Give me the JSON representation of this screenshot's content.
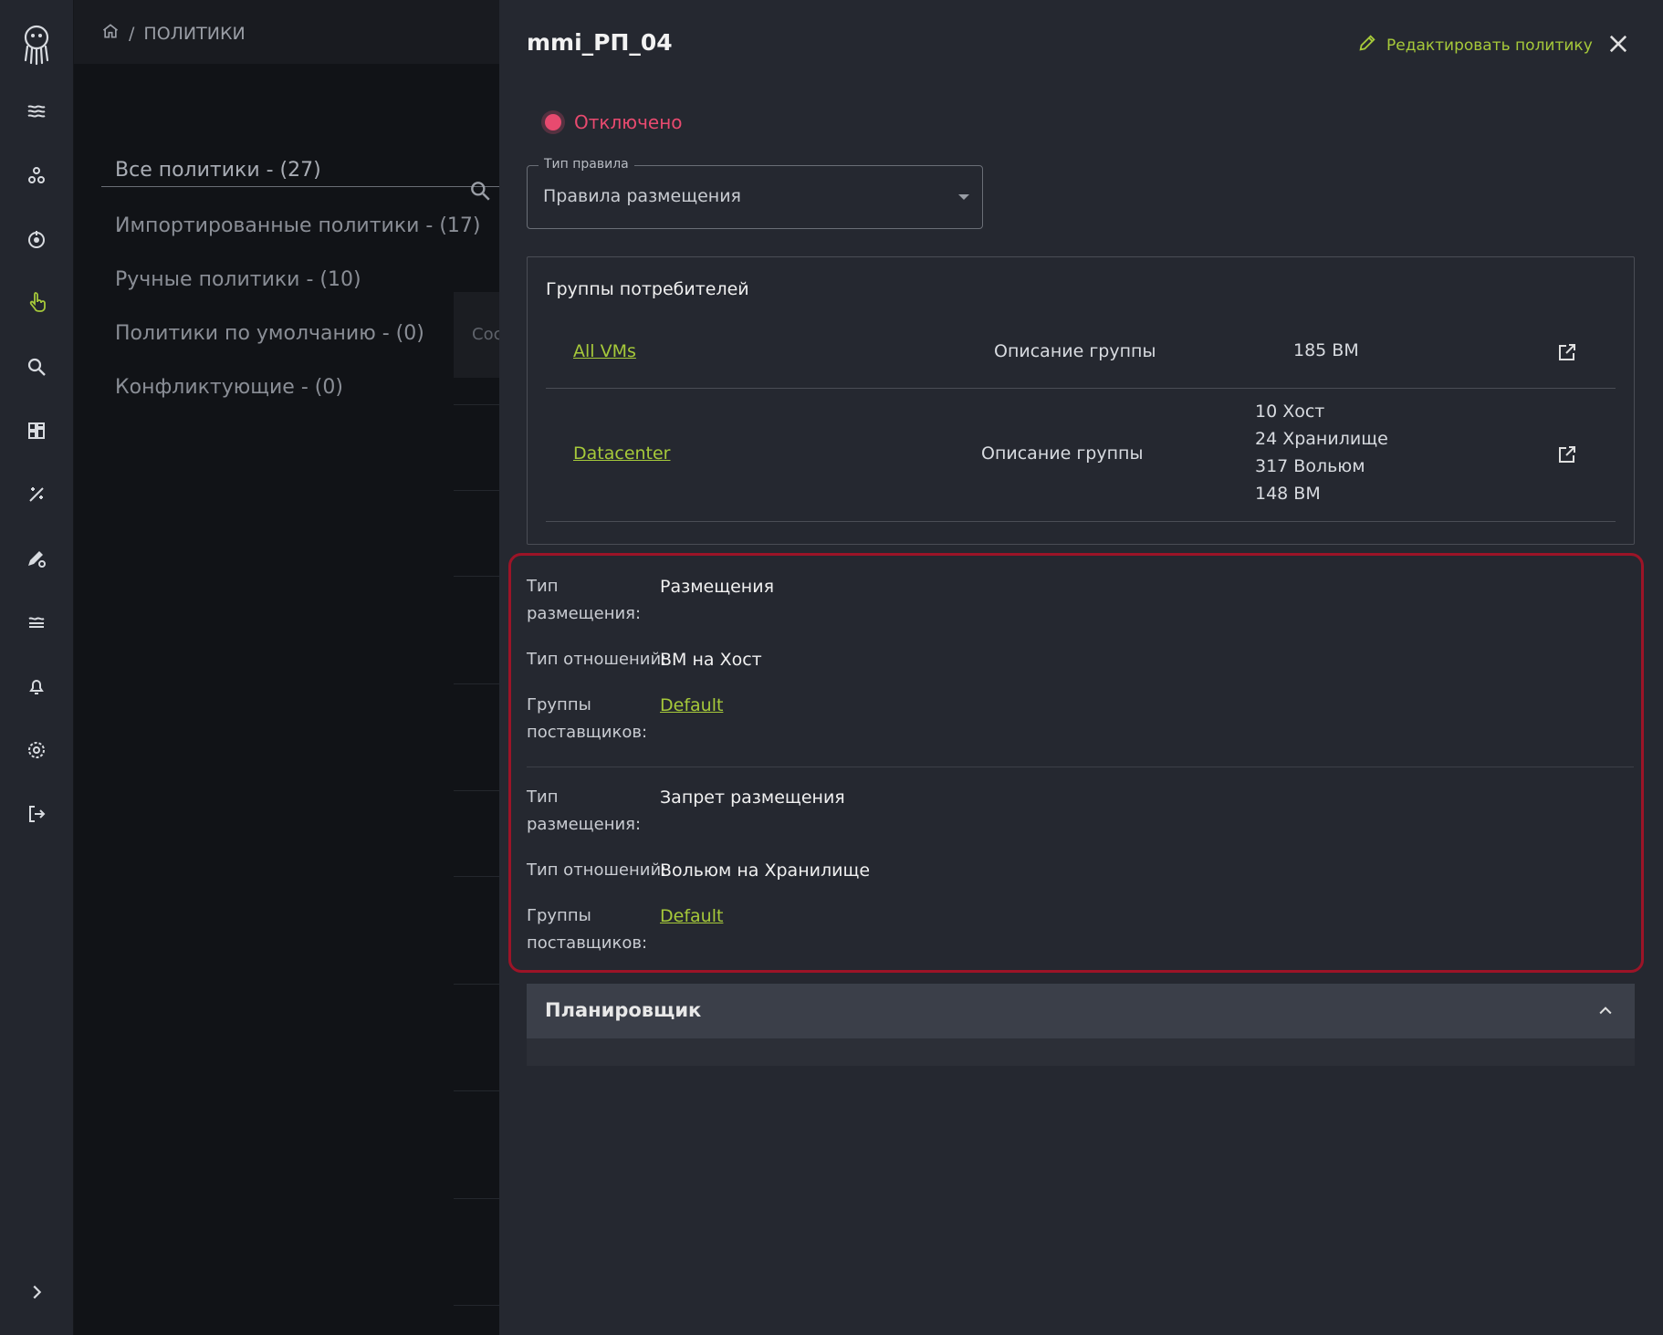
{
  "breadcrumb": {
    "section": "ПОЛИТИКИ"
  },
  "policy_tabs": [
    {
      "label": "Все политики - (27)"
    },
    {
      "label": "Импортированные политики - (17)"
    },
    {
      "label": "Ручные политики - (10)"
    },
    {
      "label": "Политики по умолчанию - (0)"
    },
    {
      "label": "Конфликтующие - (0)"
    }
  ],
  "background_table": {
    "cell_fragment": "Coc"
  },
  "drawer": {
    "title": "mmi_РП_04",
    "edit_label": "Редактировать политику",
    "status": "Отключено",
    "rule_type": {
      "label": "Тип правила",
      "value": "Правила размещения"
    },
    "consumer_groups": {
      "title": "Группы потребителей",
      "rows": [
        {
          "name": "All VMs",
          "description": "Описание группы",
          "counts": [
            "185 ВМ"
          ]
        },
        {
          "name": "Datacenter",
          "description": "Описание группы",
          "counts": [
            "10 Хост",
            "24 Хранилище",
            "317 Вольюм",
            "148 ВМ"
          ]
        }
      ]
    },
    "rules": [
      {
        "placement_label": "Тип размещения:",
        "placement_value": "Размещения",
        "relation_label": "Тип отношений:",
        "relation_value": "ВМ на Хост",
        "providers_label": "Группы поставщиков:",
        "providers_value": "Default"
      },
      {
        "placement_label": "Тип размещения:",
        "placement_value": "Запрет размещения",
        "relation_label": "Тип отношений:",
        "relation_value": "Вольюм на Хранилище",
        "providers_label": "Группы поставщиков:",
        "providers_value": "Default"
      }
    ],
    "planner": {
      "title": "Планировщик"
    }
  },
  "colors": {
    "accent": "#a6c93a",
    "status_off": "#e84a6f",
    "highlight_border": "#9c1427"
  }
}
